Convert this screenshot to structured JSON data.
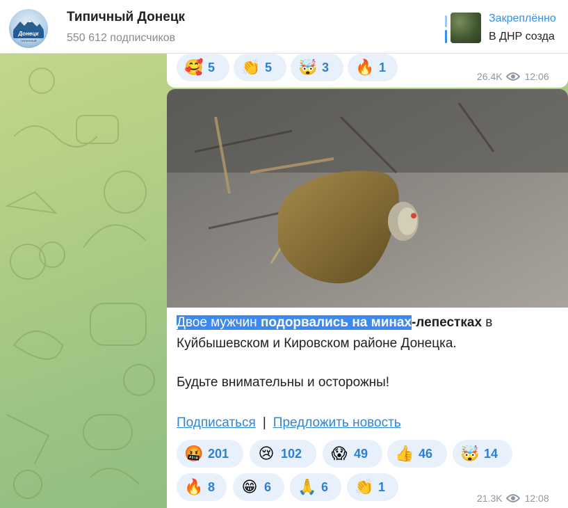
{
  "channel": {
    "title": "Типичный Донецк",
    "subscribers": "550 612 подписчиков",
    "avatar_brand": "Донецк",
    "avatar_sub": "ТИПИЧНЫЙ"
  },
  "pinned": {
    "title": "Закреплённо",
    "text": "В ДНР созда"
  },
  "previous_message": {
    "reactions": [
      {
        "emoji": "🥰",
        "count": "5"
      },
      {
        "emoji": "👏",
        "count": "5"
      },
      {
        "emoji": "🤯",
        "count": "3"
      },
      {
        "emoji": "🔥",
        "count": "1"
      }
    ],
    "views": "26.4K",
    "time": "12:06"
  },
  "message": {
    "text_highlight_plain_1": "Двое мужчин ",
    "text_highlight_bold": "подорвались на минах",
    "text_bold_tail": "-лепестках",
    "text_line1_tail": " в",
    "text_line2": "Куйбышевском и Кировском районе Донецка.",
    "text_line3": "Будьте внимательны и осторожны!",
    "link_subscribe": "Подписаться",
    "link_separator": "|",
    "link_suggest": "Предложить новость",
    "reactions": [
      {
        "emoji": "🤬",
        "count": "201"
      },
      {
        "emoji": "😢",
        "count": "102"
      },
      {
        "emoji": "😱",
        "count": "49"
      },
      {
        "emoji": "👍",
        "count": "46"
      },
      {
        "emoji": "🤯",
        "count": "14"
      },
      {
        "emoji": "🔥",
        "count": "8"
      },
      {
        "emoji": "😁",
        "count": "6"
      },
      {
        "emoji": "🙏",
        "count": "6"
      },
      {
        "emoji": "👏",
        "count": "1"
      }
    ],
    "views": "21.3K",
    "time": "12:08"
  },
  "colors": {
    "accent": "#3390ec",
    "link": "#2d86d9",
    "reaction_bg": "#e8f1fb",
    "highlight": "#3d89f0"
  }
}
